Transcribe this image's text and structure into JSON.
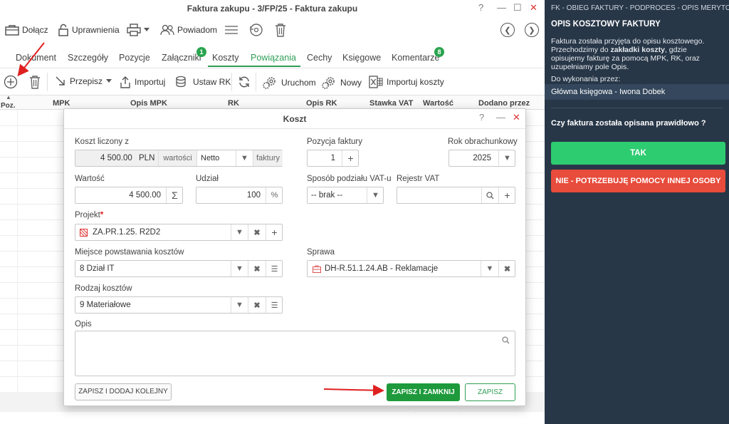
{
  "window": {
    "title": "Faktura zakupu - 3/FP/25 - Faktura zakupu",
    "help": "?",
    "minimize": "—",
    "maximize": "☐",
    "close": "✕"
  },
  "toolbar": {
    "attach_label": "Dołącz",
    "permissions_label": "Uprawnienia",
    "notify_label": "Powiadom"
  },
  "tabs": [
    {
      "label": "Dokument"
    },
    {
      "label": "Szczegóły"
    },
    {
      "label": "Pozycje"
    },
    {
      "label": "Załączniki",
      "badge": "1"
    },
    {
      "label": "Koszty"
    },
    {
      "label": "Powiązania"
    },
    {
      "label": "Cechy"
    },
    {
      "label": "Księgowe"
    },
    {
      "label": "Komentarze",
      "badge": "8"
    }
  ],
  "cost_toolbar": {
    "przepisz_label": "Przepisz",
    "importuj_label": "Importuj",
    "ustaw_rk_label": "Ustaw RK",
    "uruchom_label": "Uruchom",
    "nowy_label": "Nowy",
    "importuj_koszty_label": "Importuj koszty"
  },
  "grid": {
    "headers": [
      "Poz.",
      "MPK",
      "Opis MPK",
      "RK",
      "Opis RK",
      "Stawka VAT",
      "Wartość",
      "Dodano przez"
    ]
  },
  "dialog": {
    "title": "Koszt",
    "help": "?",
    "minimize": "—",
    "close": "✕",
    "koszt_liczony_label": "Koszt liczony z",
    "koszt_amount": "4 500.00",
    "koszt_currency": "PLN",
    "wartosci_label": "wartości",
    "netto_value": "Netto",
    "faktury_label": "faktury",
    "pozycja_label": "Pozycja faktury",
    "pozycja_value": "1",
    "rok_label": "Rok obrachunkowy",
    "rok_value": "2025",
    "wartosc_label": "Wartość",
    "wartosc_value": "4 500.00",
    "udzial_label": "Udział",
    "udzial_value": "100",
    "udzial_unit": "%",
    "sposob_label": "Sposób podziału VAT-u",
    "sposob_value": "-- brak --",
    "rejestr_label": "Rejestr VAT",
    "projekt_label": "Projekt",
    "projekt_required": "*",
    "projekt_value": "ZA.PR.1.25. R2D2",
    "mpk_label": "Miejsce powstawania kosztów",
    "mpk_value": "8 Dział IT",
    "sprawa_label": "Sprawa",
    "sprawa_value": "DH-R.51.1.24.AB - Reklamacje",
    "rodzaj_label": "Rodzaj kosztów",
    "rodzaj_value": "9 Materiałowe",
    "opis_label": "Opis",
    "save_add_label": "ZAPISZ I DODAJ KOLEJNY",
    "save_close_label": "ZAPISZ I ZAMKNIJ",
    "save_label": "ZAPISZ"
  },
  "side": {
    "breadcrumb": "FK - OBIEG FAKTURY - PODPROCES - OPIS MERYTORY...",
    "heading": "OPIS KOSZTOWY FAKTURY",
    "desc_1": "Faktura została przyjęta do opisu kosztowego. Przechodzimy do ",
    "desc_bold": "zakładki koszty",
    "desc_2": ", gdzie opisujemy fakturę za pomocą MPK, RK, oraz uzupełniamy pole Opis.",
    "todo_label": "Do wykonania przez:",
    "assignee": "Główna księgowa - Iwona Dobek",
    "question": "Czy faktura została opisana prawidłowo ?",
    "yes_label": "TAK",
    "no_label": "NIE - POTRZEBUJĘ POMOCY INNEJ OSOBY"
  },
  "colors": {
    "accent_green": "#2e9e55",
    "panel_bg": "#283748",
    "yes_green": "#2ecc71",
    "no_red": "#e74c3c",
    "arrow_red": "#e02020"
  }
}
